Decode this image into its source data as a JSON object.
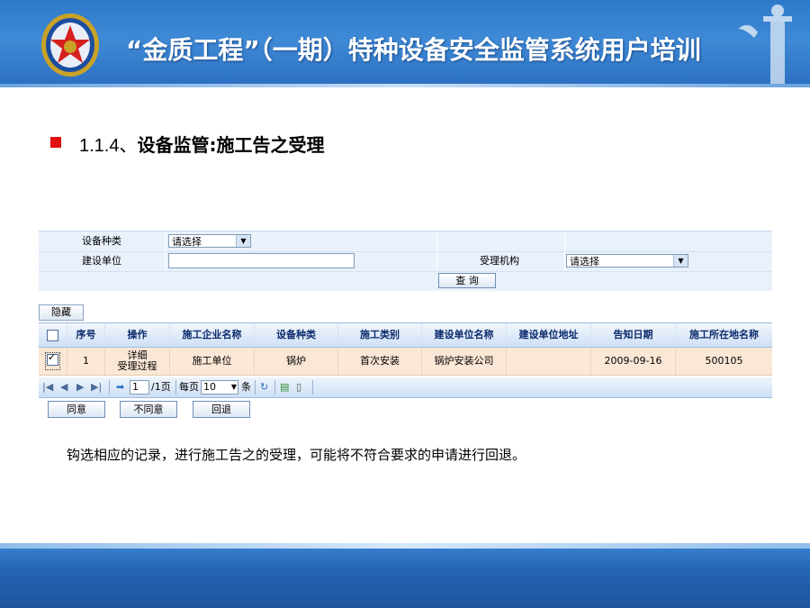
{
  "slide": {
    "title": "“金质工程”（一期）特种设备安全监管系统用户培训",
    "section_number": "1.1.4、",
    "section_text": "设备监管:施工告之受理",
    "note": "钩选相应的记录，进行施工告之的受理，可能将不符合要求的申请进行回退。"
  },
  "form": {
    "device_type_label": "设备种类",
    "device_type_value": "请选择",
    "build_unit_label": "建设单位",
    "build_unit_value": "",
    "org_label": "受理机构",
    "org_value": "请选择",
    "query_button": "查  询"
  },
  "hide_button": "隐藏",
  "table": {
    "headers": [
      "序号",
      "操作",
      "施工企业名称",
      "设备种类",
      "施工类别",
      "建设单位名称",
      "建设单位地址",
      "告知日期",
      "施工所在地名称"
    ],
    "rows": [
      {
        "checked": true,
        "index": "1",
        "op_detail": "详细",
        "op_process": "受理过程",
        "company": "施工单位",
        "device_type": "锅炉",
        "category": "首次安装",
        "build_unit": "锅炉安装公司",
        "build_address": "",
        "date": "2009-09-16",
        "location": "500105"
      }
    ]
  },
  "pager": {
    "page_input": "1",
    "total_pages": "/1页",
    "per_page_label": "每页",
    "per_page_value": "10",
    "unit": "条"
  },
  "actions": {
    "agree": "同意",
    "disagree": "不同意",
    "return": "回退"
  },
  "colors": {
    "header_blue": "#3f8ad6",
    "bullet_red": "#e01010",
    "row_highlight": "#fbe7d5"
  }
}
